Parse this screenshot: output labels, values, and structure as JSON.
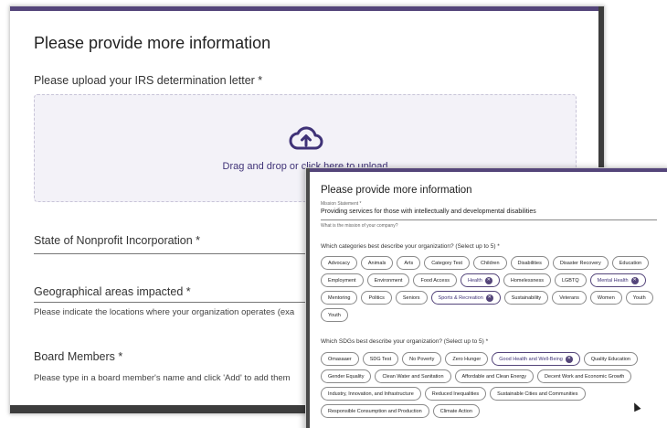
{
  "back_form": {
    "title": "Please provide more information",
    "irs_label": "Please upload your IRS determination letter *",
    "dropzone_text": "Drag and drop or click here to upload",
    "state_label": "State of Nonprofit Incorporation *",
    "geo_label": "Geographical areas impacted *",
    "geo_help": "Please indicate the locations where your organization operates (exa",
    "board_label": "Board Members *",
    "board_help": "Please type in a board member's name and click 'Add' to add them"
  },
  "front_form": {
    "title": "Please provide more information",
    "mission_label": "Mission Statement *",
    "mission_value": "Providing services for those with intellectually and developmental disabilities",
    "mission_help": "What is the mission of your company?",
    "categories_question": "Which categories best describe your organization? (Select up to 5) *",
    "categories": [
      {
        "label": "Advocacy",
        "selected": false
      },
      {
        "label": "Animals",
        "selected": false
      },
      {
        "label": "Arts",
        "selected": false
      },
      {
        "label": "Category Test",
        "selected": false
      },
      {
        "label": "Children",
        "selected": false
      },
      {
        "label": "Disabilities",
        "selected": false
      },
      {
        "label": "Disaster Recovery",
        "selected": false
      },
      {
        "label": "Education",
        "selected": false
      },
      {
        "label": "Employment",
        "selected": false
      },
      {
        "label": "Environment",
        "selected": false
      },
      {
        "label": "Food Access",
        "selected": false
      },
      {
        "label": "Health",
        "selected": true
      },
      {
        "label": "Homelessness",
        "selected": false
      },
      {
        "label": "LGBTQ",
        "selected": false
      },
      {
        "label": "Mental Health",
        "selected": true
      },
      {
        "label": "Mentoring",
        "selected": false
      },
      {
        "label": "Politics",
        "selected": false
      },
      {
        "label": "Seniors",
        "selected": false
      },
      {
        "label": "Sports & Recreation",
        "selected": true
      },
      {
        "label": "Sustainability",
        "selected": false
      },
      {
        "label": "Veterans",
        "selected": false
      },
      {
        "label": "Women",
        "selected": false
      },
      {
        "label": "Youth",
        "selected": false
      },
      {
        "label": "Youth",
        "selected": false
      }
    ],
    "sdgs_question": "Which SDGs best describe your organization? (Select up to 5) *",
    "sdgs": [
      {
        "label": "Omasaaer",
        "selected": false
      },
      {
        "label": "SDG Test",
        "selected": false
      },
      {
        "label": "No Poverty",
        "selected": false
      },
      {
        "label": "Zero Hunger",
        "selected": false
      },
      {
        "label": "Good Health and Well-Being",
        "selected": true
      },
      {
        "label": "Quality Education",
        "selected": false
      },
      {
        "label": "Gender Equality",
        "selected": false
      },
      {
        "label": "Clean Water and Sanitation",
        "selected": false
      },
      {
        "label": "Affordable and Clean Energy",
        "selected": false
      },
      {
        "label": "Decent Work and Economic Growth",
        "selected": false
      },
      {
        "label": "Industry, Innovation, and Infrastructure",
        "selected": false
      },
      {
        "label": "Reduced Inequalities",
        "selected": false
      },
      {
        "label": "Sustainable Cities and Communities",
        "selected": false
      },
      {
        "label": "Responsible Consumption and Production",
        "selected": false
      },
      {
        "label": "Climate Action",
        "selected": false
      }
    ]
  },
  "colors": {
    "accent": "#54457a",
    "accent_text": "#3f3277",
    "dropzone_bg": "#f3f2f8"
  },
  "icons": {
    "upload": "cloud-upload-icon",
    "remove": "close-icon"
  }
}
